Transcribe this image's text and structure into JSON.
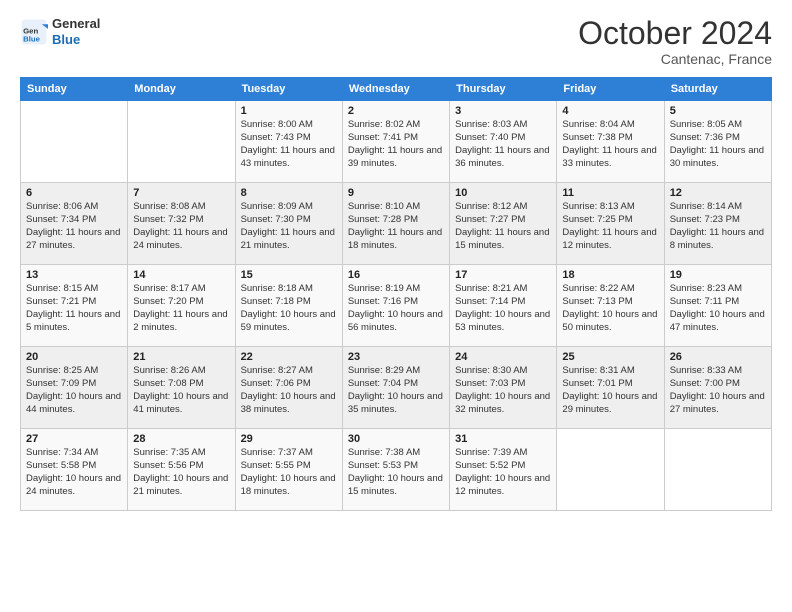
{
  "header": {
    "logo_line1": "General",
    "logo_line2": "Blue",
    "month": "October 2024",
    "location": "Cantenac, France"
  },
  "weekdays": [
    "Sunday",
    "Monday",
    "Tuesday",
    "Wednesday",
    "Thursday",
    "Friday",
    "Saturday"
  ],
  "weeks": [
    [
      {
        "day": "",
        "sunrise": "",
        "sunset": "",
        "daylight": ""
      },
      {
        "day": "",
        "sunrise": "",
        "sunset": "",
        "daylight": ""
      },
      {
        "day": "1",
        "sunrise": "Sunrise: 8:00 AM",
        "sunset": "Sunset: 7:43 PM",
        "daylight": "Daylight: 11 hours and 43 minutes."
      },
      {
        "day": "2",
        "sunrise": "Sunrise: 8:02 AM",
        "sunset": "Sunset: 7:41 PM",
        "daylight": "Daylight: 11 hours and 39 minutes."
      },
      {
        "day": "3",
        "sunrise": "Sunrise: 8:03 AM",
        "sunset": "Sunset: 7:40 PM",
        "daylight": "Daylight: 11 hours and 36 minutes."
      },
      {
        "day": "4",
        "sunrise": "Sunrise: 8:04 AM",
        "sunset": "Sunset: 7:38 PM",
        "daylight": "Daylight: 11 hours and 33 minutes."
      },
      {
        "day": "5",
        "sunrise": "Sunrise: 8:05 AM",
        "sunset": "Sunset: 7:36 PM",
        "daylight": "Daylight: 11 hours and 30 minutes."
      }
    ],
    [
      {
        "day": "6",
        "sunrise": "Sunrise: 8:06 AM",
        "sunset": "Sunset: 7:34 PM",
        "daylight": "Daylight: 11 hours and 27 minutes."
      },
      {
        "day": "7",
        "sunrise": "Sunrise: 8:08 AM",
        "sunset": "Sunset: 7:32 PM",
        "daylight": "Daylight: 11 hours and 24 minutes."
      },
      {
        "day": "8",
        "sunrise": "Sunrise: 8:09 AM",
        "sunset": "Sunset: 7:30 PM",
        "daylight": "Daylight: 11 hours and 21 minutes."
      },
      {
        "day": "9",
        "sunrise": "Sunrise: 8:10 AM",
        "sunset": "Sunset: 7:28 PM",
        "daylight": "Daylight: 11 hours and 18 minutes."
      },
      {
        "day": "10",
        "sunrise": "Sunrise: 8:12 AM",
        "sunset": "Sunset: 7:27 PM",
        "daylight": "Daylight: 11 hours and 15 minutes."
      },
      {
        "day": "11",
        "sunrise": "Sunrise: 8:13 AM",
        "sunset": "Sunset: 7:25 PM",
        "daylight": "Daylight: 11 hours and 12 minutes."
      },
      {
        "day": "12",
        "sunrise": "Sunrise: 8:14 AM",
        "sunset": "Sunset: 7:23 PM",
        "daylight": "Daylight: 11 hours and 8 minutes."
      }
    ],
    [
      {
        "day": "13",
        "sunrise": "Sunrise: 8:15 AM",
        "sunset": "Sunset: 7:21 PM",
        "daylight": "Daylight: 11 hours and 5 minutes."
      },
      {
        "day": "14",
        "sunrise": "Sunrise: 8:17 AM",
        "sunset": "Sunset: 7:20 PM",
        "daylight": "Daylight: 11 hours and 2 minutes."
      },
      {
        "day": "15",
        "sunrise": "Sunrise: 8:18 AM",
        "sunset": "Sunset: 7:18 PM",
        "daylight": "Daylight: 10 hours and 59 minutes."
      },
      {
        "day": "16",
        "sunrise": "Sunrise: 8:19 AM",
        "sunset": "Sunset: 7:16 PM",
        "daylight": "Daylight: 10 hours and 56 minutes."
      },
      {
        "day": "17",
        "sunrise": "Sunrise: 8:21 AM",
        "sunset": "Sunset: 7:14 PM",
        "daylight": "Daylight: 10 hours and 53 minutes."
      },
      {
        "day": "18",
        "sunrise": "Sunrise: 8:22 AM",
        "sunset": "Sunset: 7:13 PM",
        "daylight": "Daylight: 10 hours and 50 minutes."
      },
      {
        "day": "19",
        "sunrise": "Sunrise: 8:23 AM",
        "sunset": "Sunset: 7:11 PM",
        "daylight": "Daylight: 10 hours and 47 minutes."
      }
    ],
    [
      {
        "day": "20",
        "sunrise": "Sunrise: 8:25 AM",
        "sunset": "Sunset: 7:09 PM",
        "daylight": "Daylight: 10 hours and 44 minutes."
      },
      {
        "day": "21",
        "sunrise": "Sunrise: 8:26 AM",
        "sunset": "Sunset: 7:08 PM",
        "daylight": "Daylight: 10 hours and 41 minutes."
      },
      {
        "day": "22",
        "sunrise": "Sunrise: 8:27 AM",
        "sunset": "Sunset: 7:06 PM",
        "daylight": "Daylight: 10 hours and 38 minutes."
      },
      {
        "day": "23",
        "sunrise": "Sunrise: 8:29 AM",
        "sunset": "Sunset: 7:04 PM",
        "daylight": "Daylight: 10 hours and 35 minutes."
      },
      {
        "day": "24",
        "sunrise": "Sunrise: 8:30 AM",
        "sunset": "Sunset: 7:03 PM",
        "daylight": "Daylight: 10 hours and 32 minutes."
      },
      {
        "day": "25",
        "sunrise": "Sunrise: 8:31 AM",
        "sunset": "Sunset: 7:01 PM",
        "daylight": "Daylight: 10 hours and 29 minutes."
      },
      {
        "day": "26",
        "sunrise": "Sunrise: 8:33 AM",
        "sunset": "Sunset: 7:00 PM",
        "daylight": "Daylight: 10 hours and 27 minutes."
      }
    ],
    [
      {
        "day": "27",
        "sunrise": "Sunrise: 7:34 AM",
        "sunset": "Sunset: 5:58 PM",
        "daylight": "Daylight: 10 hours and 24 minutes."
      },
      {
        "day": "28",
        "sunrise": "Sunrise: 7:35 AM",
        "sunset": "Sunset: 5:56 PM",
        "daylight": "Daylight: 10 hours and 21 minutes."
      },
      {
        "day": "29",
        "sunrise": "Sunrise: 7:37 AM",
        "sunset": "Sunset: 5:55 PM",
        "daylight": "Daylight: 10 hours and 18 minutes."
      },
      {
        "day": "30",
        "sunrise": "Sunrise: 7:38 AM",
        "sunset": "Sunset: 5:53 PM",
        "daylight": "Daylight: 10 hours and 15 minutes."
      },
      {
        "day": "31",
        "sunrise": "Sunrise: 7:39 AM",
        "sunset": "Sunset: 5:52 PM",
        "daylight": "Daylight: 10 hours and 12 minutes."
      },
      {
        "day": "",
        "sunrise": "",
        "sunset": "",
        "daylight": ""
      },
      {
        "day": "",
        "sunrise": "",
        "sunset": "",
        "daylight": ""
      }
    ]
  ]
}
